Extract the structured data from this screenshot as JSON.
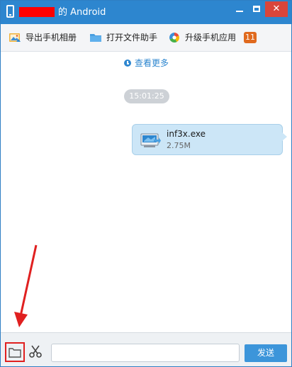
{
  "titlebar": {
    "title": "的 Android",
    "minimize_icon": "minimize-icon",
    "maximize_icon": "maximize-icon",
    "close_icon": "close-icon",
    "close_glyph": "✕",
    "accent": "#2d86cf",
    "redaction_color": "#ff0000"
  },
  "toolbar": {
    "export_album": {
      "label": "导出手机相册",
      "icon": "photo-export-icon"
    },
    "file_assistant": {
      "label": "打开文件助手",
      "icon": "folder-icon"
    },
    "upgrade_apps": {
      "label": "升级手机应用",
      "icon": "app-upgrade-icon"
    },
    "update_count": "11"
  },
  "messages": {
    "view_more": "查看更多",
    "timestamp": "15:01:25",
    "file": {
      "name": "inf3x.exe",
      "size": "2.75M",
      "icon": "exe-file-icon"
    }
  },
  "bottombar": {
    "folder_icon": "folder-icon",
    "scissors_icon": "scissors-icon",
    "input_value": "",
    "send_label": "发送"
  },
  "colors": {
    "bubble": "#cce6f7",
    "badge": "#e06a1e",
    "annotation": "#e02020",
    "send_button": "#3c95da"
  }
}
